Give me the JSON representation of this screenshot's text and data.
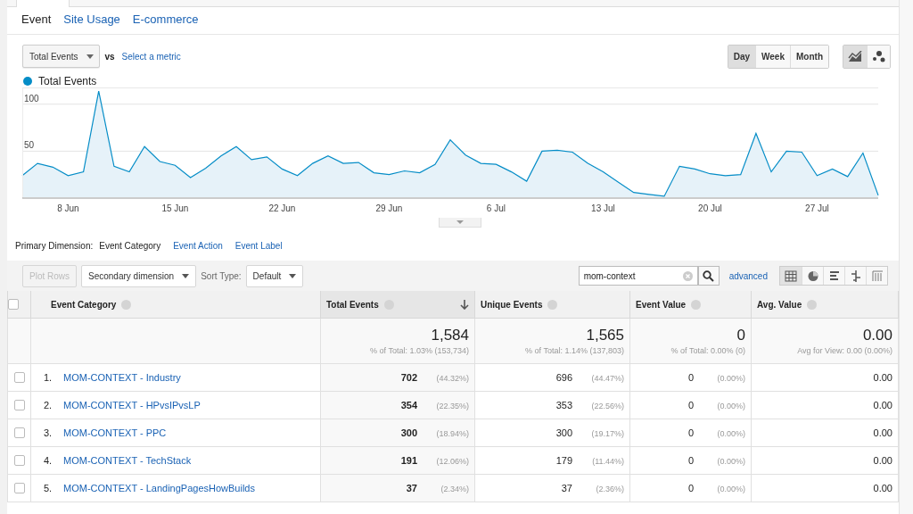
{
  "report_tabs": [
    {
      "label": "Event",
      "selected": true
    },
    {
      "label": "Site Usage",
      "selected": false
    },
    {
      "label": "E-commerce",
      "selected": false
    }
  ],
  "metric_selector": {
    "value": "Total Events",
    "vs_label": "vs",
    "select_metric": "Select a metric"
  },
  "time_buttons": [
    {
      "label": "Day",
      "selected": true
    },
    {
      "label": "Week",
      "selected": false
    },
    {
      "label": "Month",
      "selected": false
    }
  ],
  "chart_type_buttons": [
    {
      "kind": "line",
      "selected": true
    },
    {
      "kind": "motion",
      "selected": false
    }
  ],
  "chart": {
    "chart_data": {
      "type": "area",
      "categories": [
        null,
        null,
        null,
        "8 Jun",
        null,
        null,
        null,
        null,
        null,
        null,
        "15 Jun",
        null,
        null,
        null,
        null,
        null,
        null,
        "22 Jun",
        null,
        null,
        null,
        null,
        null,
        null,
        "29 Jun",
        null,
        null,
        null,
        null,
        null,
        null,
        "6 Jul",
        null,
        null,
        null,
        null,
        null,
        null,
        "13 Jul",
        null,
        null,
        null,
        null,
        null,
        null,
        "20 Jul",
        null,
        null,
        null,
        null,
        null,
        null,
        "27 Jul",
        null,
        null,
        null,
        null
      ],
      "series": [
        {
          "name": "Total Events",
          "color": "#058dc7",
          "values": [
            23,
            36,
            32,
            23,
            27,
            113,
            33,
            27,
            54,
            38,
            34,
            21,
            31,
            44,
            54,
            40,
            43,
            30,
            23,
            36,
            44,
            36,
            37,
            26,
            24,
            28,
            26,
            35,
            61,
            45,
            36,
            35,
            27,
            17,
            49,
            50,
            48,
            36,
            27,
            16,
            5,
            3,
            1,
            33,
            30,
            25,
            23,
            24,
            68,
            27,
            49,
            48,
            23,
            30,
            22,
            47,
            2
          ]
        }
      ],
      "ylim": [
        0,
        115
      ],
      "yticks": [
        50,
        100
      ]
    }
  },
  "primary_dimension": {
    "label": "Primary Dimension:",
    "options": [
      {
        "label": "Event Category",
        "selected": true
      },
      {
        "label": "Event Action",
        "selected": false
      },
      {
        "label": "Event Label",
        "selected": false
      }
    ]
  },
  "toolbar": {
    "plot_rows": {
      "label": "Plot Rows",
      "disabled": true
    },
    "secondary_dimension": "Secondary dimension",
    "sort_type_label": "Sort Type:",
    "sort_type": "Default",
    "search": {
      "value": "mom-context"
    },
    "advanced": "advanced",
    "view_buttons": [
      {
        "kind": "table",
        "selected": true
      },
      {
        "kind": "pie",
        "selected": false
      },
      {
        "kind": "bars",
        "selected": false
      },
      {
        "kind": "comparison",
        "selected": false
      },
      {
        "kind": "pivot",
        "selected": false
      }
    ]
  },
  "table": {
    "all_checked": false,
    "columns": [
      {
        "label": "Event Category",
        "sorted": false
      },
      {
        "label": "Total Events",
        "sorted": true
      },
      {
        "label": "Unique Events",
        "sorted": false
      },
      {
        "label": "Event Value",
        "sorted": false
      },
      {
        "label": "Avg. Value",
        "sorted": false
      }
    ],
    "totals": [
      {
        "value": "1,584",
        "note": "% of Total: 1.03% (153,734)"
      },
      {
        "value": "1,565",
        "note": "% of Total: 1.14% (137,803)"
      },
      {
        "value": "0",
        "note": "% of Total: 0.00% (0)"
      },
      {
        "value": "0.00",
        "note": "Avg for View: 0.00 (0.00%)"
      }
    ],
    "rows": [
      {
        "checked": false,
        "cells": [
          {
            "index": "1.",
            "value": "MOM-CONTEXT - Industry"
          },
          {
            "value": "702",
            "pct": "(44.32%)"
          },
          {
            "value": "696",
            "pct": "(44.47%)"
          },
          {
            "value": "0",
            "pct": "(0.00%)"
          },
          {
            "value": "0.00"
          }
        ]
      },
      {
        "checked": false,
        "cells": [
          {
            "index": "2.",
            "value": "MOM-CONTEXT - HPvsIPvsLP"
          },
          {
            "value": "354",
            "pct": "(22.35%)"
          },
          {
            "value": "353",
            "pct": "(22.56%)"
          },
          {
            "value": "0",
            "pct": "(0.00%)"
          },
          {
            "value": "0.00"
          }
        ]
      },
      {
        "checked": false,
        "cells": [
          {
            "index": "3.",
            "value": "MOM-CONTEXT - PPC"
          },
          {
            "value": "300",
            "pct": "(18.94%)"
          },
          {
            "value": "300",
            "pct": "(19.17%)"
          },
          {
            "value": "0",
            "pct": "(0.00%)"
          },
          {
            "value": "0.00"
          }
        ]
      },
      {
        "checked": false,
        "cells": [
          {
            "index": "4.",
            "value": "MOM-CONTEXT - TechStack"
          },
          {
            "value": "191",
            "pct": "(12.06%)"
          },
          {
            "value": "179",
            "pct": "(11.44%)"
          },
          {
            "value": "0",
            "pct": "(0.00%)"
          },
          {
            "value": "0.00"
          }
        ]
      },
      {
        "checked": false,
        "cells": [
          {
            "index": "5.",
            "value": "MOM-CONTEXT - LandingPagesHowBuilds"
          },
          {
            "value": "37",
            "pct": "(2.34%)"
          },
          {
            "value": "37",
            "pct": "(2.36%)"
          },
          {
            "value": "0",
            "pct": "(0.00%)"
          },
          {
            "value": "0.00"
          }
        ]
      }
    ]
  }
}
